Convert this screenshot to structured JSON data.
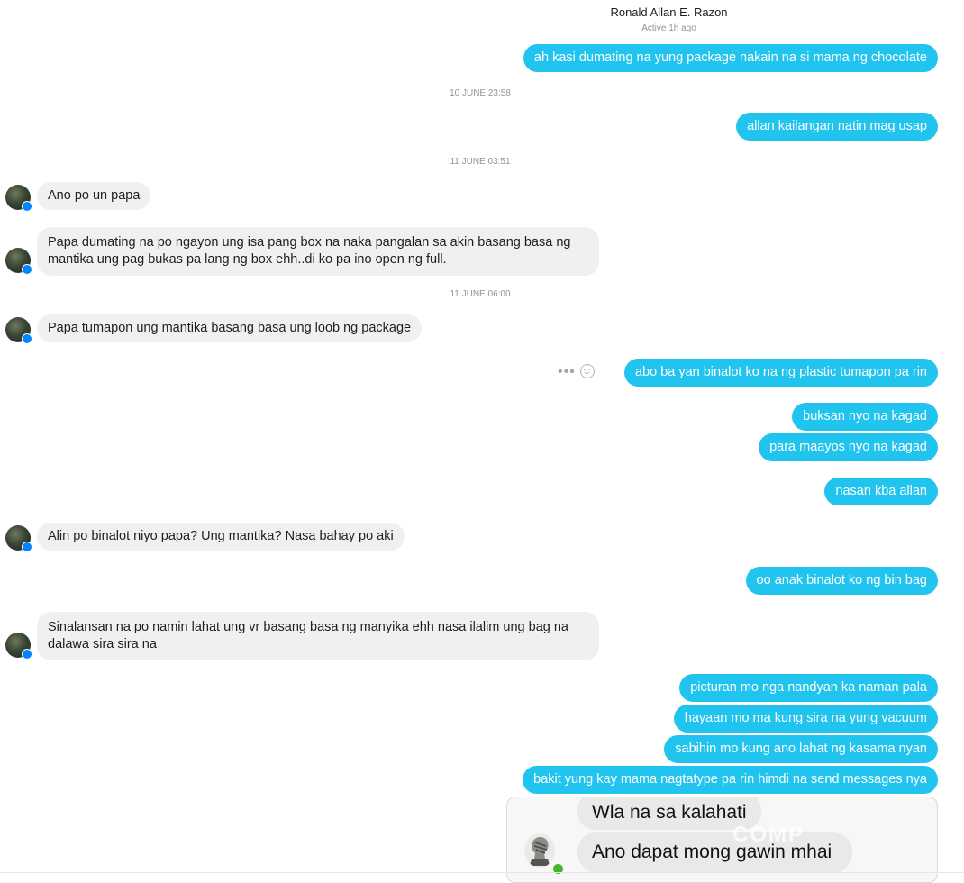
{
  "header": {
    "name": "Ronald Allan E. Razon",
    "status": "Active 1h ago"
  },
  "timestamps": [
    "10 JUNE 23:58",
    "11 JUNE 03:51",
    "11 JUNE 06:00"
  ],
  "messages": [
    {
      "from": "me",
      "text": "ah kasi dumating na yung package nakain na si mama ng chocolate"
    },
    {
      "from": "me",
      "text": "allan kailangan natin mag usap"
    },
    {
      "from": "them",
      "text": "Ano po un papa"
    },
    {
      "from": "them",
      "text": "Papa dumating na po ngayon ung isa pang box na naka pangalan sa akin basang basa ng mantika ung pag bukas pa lang ng box ehh..di ko pa ino open ng full."
    },
    {
      "from": "them",
      "text": "Papa tumapon ung mantika basang basa ung loob ng package"
    },
    {
      "from": "me",
      "text": "abo ba yan binalot ko na ng plastic tumapon pa rin"
    },
    {
      "from": "me",
      "text": "buksan nyo na kagad"
    },
    {
      "from": "me",
      "text": "para maayos nyo na kagad"
    },
    {
      "from": "me",
      "text": "nasan kba allan"
    },
    {
      "from": "them",
      "text": "Alin po binalot niyo papa? Ung mantika? Nasa bahay po aki"
    },
    {
      "from": "me",
      "text": "oo anak binalot ko ng bin bag"
    },
    {
      "from": "them",
      "text": "Sinalansan na po namin lahat ung vr basang basa ng manyika ehh nasa ilalim ung bag na dalawa sira sira na"
    },
    {
      "from": "me",
      "text": "picturan mo nga nandyan ka naman pala"
    },
    {
      "from": "me",
      "text": "hayaan mo ma kung sira na yung vacuum"
    },
    {
      "from": "me",
      "text": "sabihin mo kung ano lahat ng kasama nyan"
    },
    {
      "from": "me",
      "text": "bakit yung kay mama nagtatype pa rin himdi na send messages nya"
    }
  ],
  "attachment": {
    "bubble1": "Wla na sa kalahati",
    "bubble2": "Ano dapat mong gawin mhai",
    "watermark": "COMP"
  },
  "icons": {
    "more": "more-dots-icon",
    "react": "smiley-react-icon",
    "messenger_badge": "messenger-badge-icon"
  },
  "colors": {
    "sent_bubble": "#21c4ee",
    "received_bubble": "#f1f0f0",
    "timestamp": "#90949c",
    "online_dot": "#42b72a"
  }
}
